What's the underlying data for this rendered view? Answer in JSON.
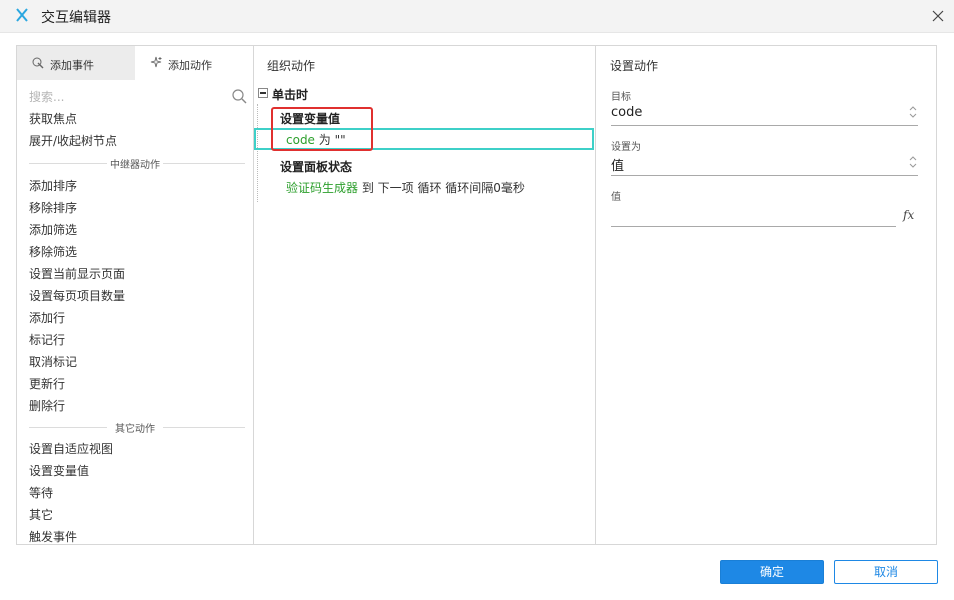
{
  "window": {
    "title": "交互编辑器"
  },
  "left": {
    "tabs": [
      {
        "label": "添加事件",
        "active": true
      },
      {
        "label": "添加动作",
        "active": false
      }
    ],
    "search_placeholder": "搜索...",
    "items_top": [
      "获取焦点",
      "展开/收起树节点"
    ],
    "section_relay": "中继器动作",
    "items_relay": [
      "添加排序",
      "移除排序",
      "添加筛选",
      "移除筛选",
      "设置当前显示页面",
      "设置每页项目数量",
      "添加行",
      "标记行",
      "取消标记",
      "更新行",
      "删除行"
    ],
    "section_other": "其它动作",
    "items_other": [
      "设置自适应视图",
      "设置变量值",
      "等待",
      "其它",
      "触发事件"
    ]
  },
  "middle": {
    "header": "组织动作",
    "event": "单击时",
    "action1": {
      "title": "设置变量值",
      "target": "code",
      "verb": "为",
      "value": "\"\""
    },
    "action2": {
      "title": "设置面板状态",
      "target": "验证码生成器",
      "detail": "到 下一项 循环 循环间隔0毫秒"
    }
  },
  "right": {
    "header": "设置动作",
    "target_label": "目标",
    "target_value": "code",
    "setas_label": "设置为",
    "setas_value": "值",
    "value_label": "值",
    "fx": "fx"
  },
  "footer": {
    "ok": "确定",
    "cancel": "取消"
  },
  "colors": {
    "accent": "#1e88e5",
    "highlight_red": "#e0302f",
    "selection_teal": "#3ed0c8",
    "green_text": "#2c9f2c"
  },
  "icons": [
    "app-logo-icon",
    "close-icon",
    "add-event-icon",
    "add-action-icon",
    "search-icon",
    "select-arrows-icon",
    "fx-icon"
  ]
}
